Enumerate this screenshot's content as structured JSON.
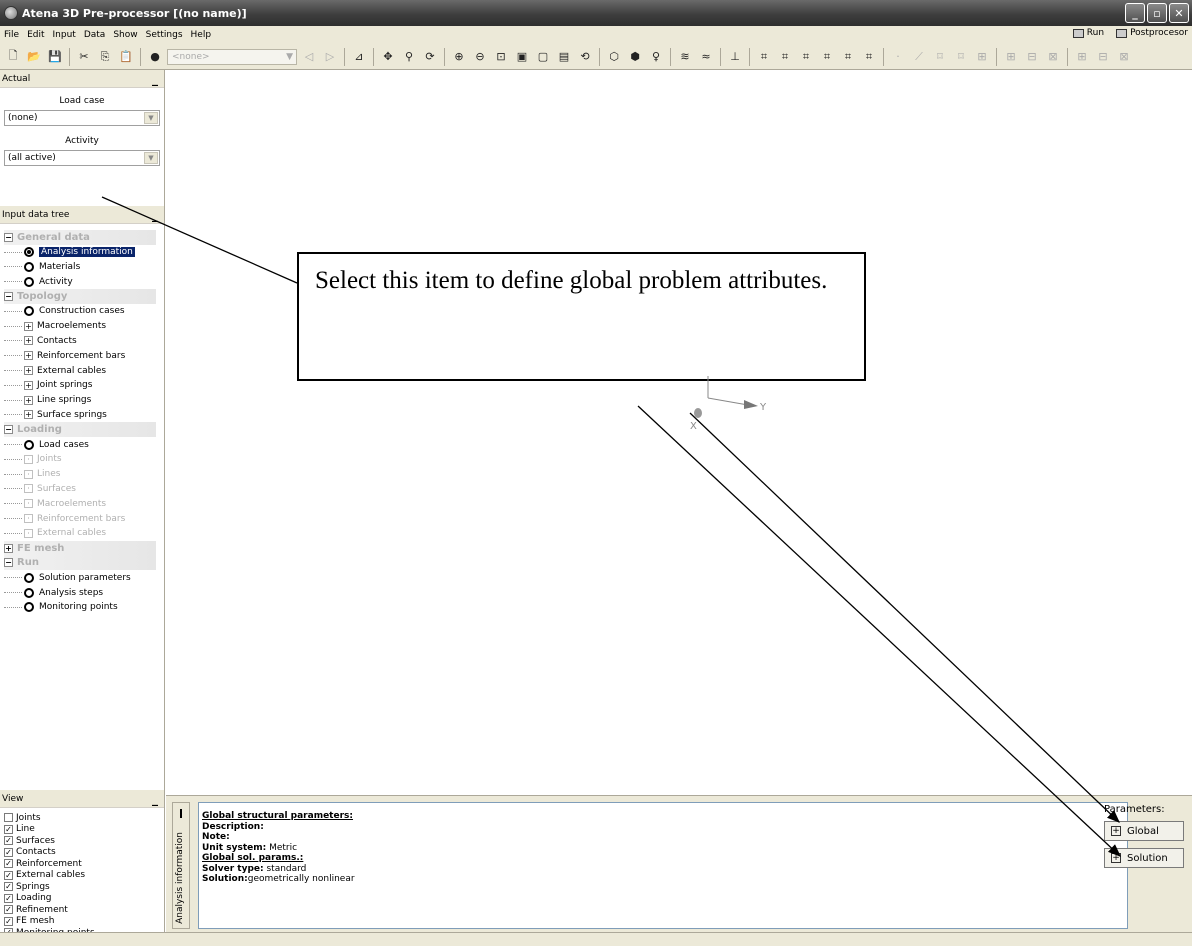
{
  "window": {
    "title": "Atena 3D Pre-processor [(no name)]"
  },
  "menu": {
    "items": [
      "File",
      "Edit",
      "Input",
      "Data",
      "Show",
      "Settings",
      "Help"
    ],
    "run_label": "Run",
    "postprocessor_label": "Postprocesor"
  },
  "toolbar": {
    "combo_value": "<none>"
  },
  "actual": {
    "header": "Actual",
    "load_case_label": "Load case",
    "load_case_value": "(none)",
    "activity_label": "Activity",
    "activity_value": "(all active)"
  },
  "tree": {
    "header": "Input data tree",
    "general": "General data",
    "analysis_information": "Analysis information",
    "materials": "Materials",
    "activity": "Activity",
    "topology": "Topology",
    "construction_cases": "Construction cases",
    "macroelements": "Macroelements",
    "contacts": "Contacts",
    "reinforcement_bars": "Reinforcement bars",
    "external_cables": "External cables",
    "joint_springs": "Joint springs",
    "line_springs": "Line springs",
    "surface_springs": "Surface springs",
    "loading": "Loading",
    "load_cases": "Load cases",
    "joints": "Joints",
    "lines": "Lines",
    "surfaces": "Surfaces",
    "loading_macroelements": "Macroelements",
    "loading_reinforcement_bars": "Reinforcement bars",
    "loading_external_cables": "External cables",
    "fe_mesh": "FE mesh",
    "run": "Run",
    "solution_parameters": "Solution parameters",
    "analysis_steps": "Analysis steps",
    "monitoring_points": "Monitoring points"
  },
  "view": {
    "header": "View",
    "items": [
      {
        "label": "Joints",
        "checked": false
      },
      {
        "label": "Line",
        "checked": true
      },
      {
        "label": "Surfaces",
        "checked": true
      },
      {
        "label": "Contacts",
        "checked": true
      },
      {
        "label": "Reinforcement",
        "checked": true
      },
      {
        "label": "External cables",
        "checked": true
      },
      {
        "label": "Springs",
        "checked": true
      },
      {
        "label": "Loading",
        "checked": true
      },
      {
        "label": "Refinement",
        "checked": true
      },
      {
        "label": "FE mesh",
        "checked": true
      },
      {
        "label": "Monitoring points",
        "checked": true
      }
    ]
  },
  "viewport": {
    "callout_text": "Select this item to define global problem attributes.",
    "axis_x": "X",
    "axis_y": "Y"
  },
  "bottom": {
    "tab_label": "Analysis information",
    "info": {
      "title": "Global structural parameters:",
      "description_label": "Description:",
      "note_label": "Note:",
      "unit_system_label": "Unit system:",
      "unit_system_value": " Metric",
      "global_sol_label": "Global sol. params.:",
      "solver_type_label": "Solver type:",
      "solver_type_value": " standard",
      "solution_label": "Solution:",
      "solution_value": "geometrically nonlinear"
    },
    "parameters_label": "Parameters:",
    "global_button": "Global",
    "solution_button": "Solution"
  }
}
